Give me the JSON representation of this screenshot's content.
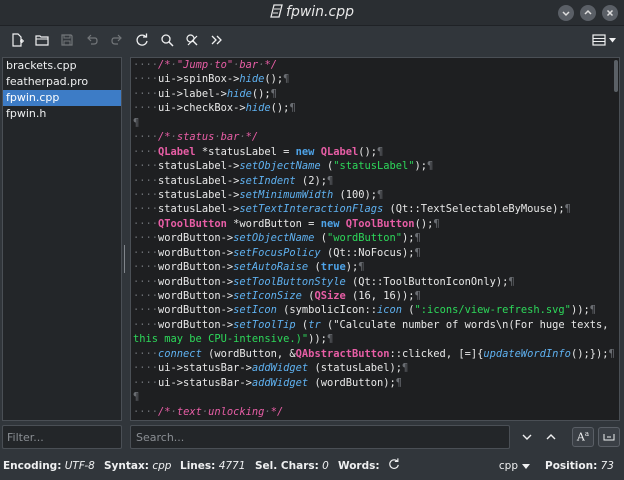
{
  "window": {
    "title": "fpwin.cpp"
  },
  "toolbar": {
    "buttons": [
      "new-file",
      "open-file",
      "save-file",
      "undo",
      "redo",
      "reload",
      "find",
      "clear",
      "jump"
    ],
    "menu_icon": "hamburger-menu-icon"
  },
  "sidebar": {
    "items": [
      {
        "label": "brackets.cpp",
        "selected": false
      },
      {
        "label": "featherpad.pro",
        "selected": false
      },
      {
        "label": "fpwin.cpp",
        "selected": true
      },
      {
        "label": "fpwin.h",
        "selected": false
      }
    ]
  },
  "editor": {
    "lines": [
      "    /* \"Jump to\" bar */",
      "    ui->spinBox->hide();",
      "    ui->label->hide();",
      "    ui->checkBox->hide();",
      "",
      "    /* status bar */",
      "    QLabel *statusLabel = new QLabel();",
      "    statusLabel->setObjectName (\"statusLabel\");",
      "    statusLabel->setIndent (2);",
      "    statusLabel->setMinimumWidth (100);",
      "    statusLabel->setTextInteractionFlags (Qt::TextSelectableByMouse);",
      "    QToolButton *wordButton = new QToolButton();",
      "    wordButton->setObjectName (\"wordButton\");",
      "    wordButton->setFocusPolicy (Qt::NoFocus);",
      "    wordButton->setAutoRaise (true);",
      "    wordButton->setToolButtonStyle (Qt::ToolButtonIconOnly);",
      "    wordButton->setIconSize (QSize (16, 16));",
      "    wordButton->setIcon (symbolicIcon::icon (\":icons/view-refresh.svg\"));",
      "    wordButton->setToolTip (tr (\"Calculate number of words\\n(For huge texts, this may be CPU-intensive.)\"));",
      "    connect (wordButton, &QAbstractButton::clicked, [=]{updateWordInfo();});",
      "    ui->statusBar->addWidget (statusLabel);",
      "    ui->statusBar->addWidget (wordButton);",
      "",
      "    /* text unlocking */"
    ]
  },
  "filter": {
    "placeholder": "Filter..."
  },
  "search": {
    "placeholder": "Search..."
  },
  "statusbar": {
    "encoding_label": "Encoding:",
    "encoding_value": "UTF-8",
    "syntax_label": "Syntax:",
    "syntax_value": "cpp",
    "lines_label": "Lines:",
    "lines_value": "4771",
    "selchars_label": "Sel. Chars:",
    "selchars_value": "0",
    "words_label": "Words:",
    "language": "cpp",
    "position_label": "Position:",
    "position_value": "73"
  },
  "colors": {
    "comment": "#e85ea6",
    "keyword": "#e85ea6",
    "new": "#4ea3e8",
    "function": "#5fb1f0",
    "string": "#2dd85a",
    "selection": "#3d7cc6"
  }
}
